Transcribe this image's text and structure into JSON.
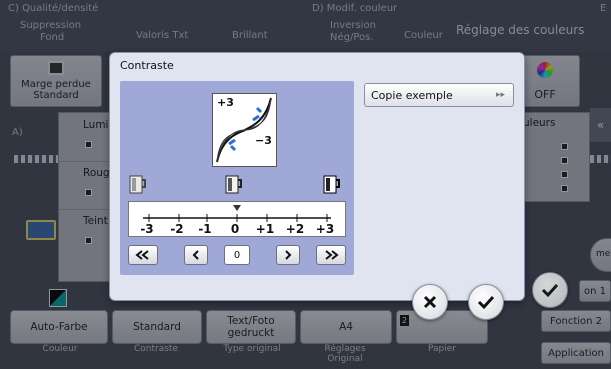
{
  "background": {
    "header_c_title": "C)  Qualité/densité",
    "header_c_sub1": "Suppression",
    "header_c_sub2": "Fond",
    "header_valoris": "Valoris Txt",
    "header_brillant": "Brillant",
    "header_d_title": "D)  Modif. couleur",
    "header_d_sub1": "Inversion",
    "header_d_sub2": "Nég/Pos.",
    "header_couleur": "Couleur",
    "header_reglage": "Réglage des couleurs",
    "header_e": "E",
    "marge_perdue": "Marge perdue",
    "standard_top": "Standard",
    "section_a": "A)",
    "off_label": "OFF",
    "lumi": "Lumi",
    "roug": "Roug",
    "teint": "Teint",
    "couleurs_partial": "uleurs",
    "mer_partial": "mer",
    "fn1_partial": "on 1",
    "bottom_buttons": [
      "Auto-Farbe",
      "Standard",
      "Text/Foto gedruckt",
      "A4"
    ],
    "bottom_captions": [
      "Couleur",
      "Contraste",
      "Type original",
      "Réglages Original",
      "Papier"
    ],
    "right_buttons": [
      "Fonction 2",
      "Application"
    ]
  },
  "dialog": {
    "title": "Contraste",
    "scale_labels": [
      "-3",
      "-2",
      "-1",
      "0",
      "+1",
      "+2",
      "+3"
    ],
    "curve_plus": "+3",
    "curve_minus": "−3",
    "current_value": "0",
    "proof_button": "Copie exemple",
    "nav": {
      "fast_back": "«‹",
      "back": "‹",
      "fwd": "›",
      "fast_fwd": "›»"
    }
  },
  "accent_colors": {
    "dialog_bg": "#dfe4f0",
    "contrast_panel": "#9fa8d6"
  }
}
